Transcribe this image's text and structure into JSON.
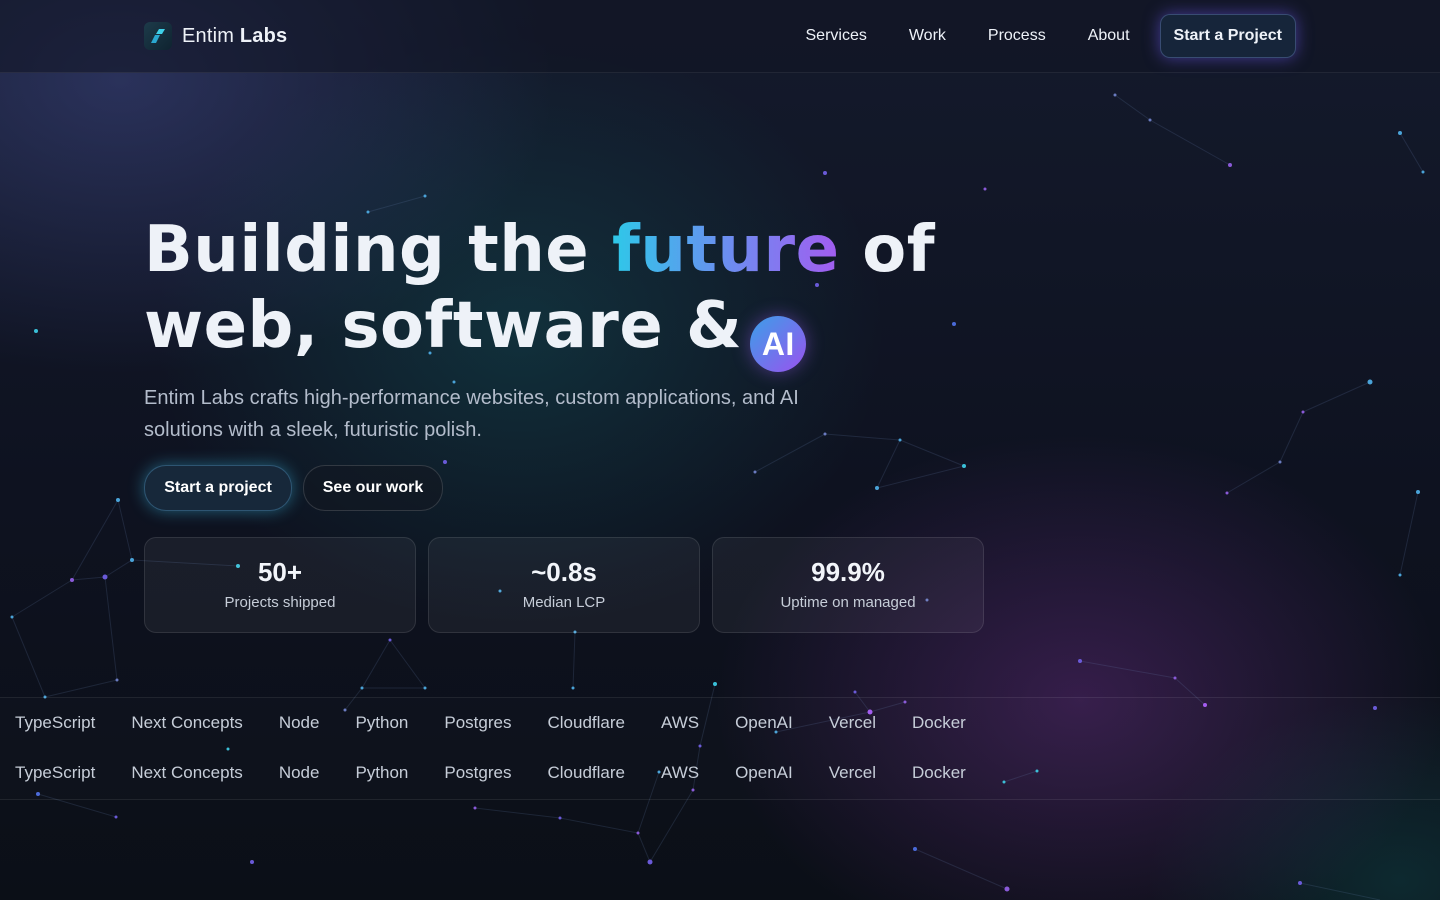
{
  "nav": {
    "brand_first": "Entim",
    "brand_second": "Labs",
    "links": [
      "Services",
      "Work",
      "Process",
      "About"
    ],
    "cta": "Start a Project"
  },
  "hero": {
    "title_part1": "Building the",
    "title_highlight": "future",
    "title_part2": "of",
    "title_line2": "web, software &",
    "ai_badge": "AI",
    "subtitle": "Entim Labs crafts high-performance websites, custom applications, and AI solutions with a sleek, futuristic polish.",
    "primary_button": "Start a project",
    "secondary_button": "See our work"
  },
  "stats": [
    {
      "value": "50+",
      "label": "Projects shipped"
    },
    {
      "value": "~0.8s",
      "label": "Median LCP"
    },
    {
      "value": "99.9%",
      "label": "Uptime on managed"
    }
  ],
  "tech_rows": [
    [
      "TypeScript",
      "Next Concepts",
      "Node",
      "Python",
      "Postgres",
      "Cloudflare",
      "AWS",
      "OpenAI",
      "Vercel",
      "Docker"
    ],
    [
      "TypeScript",
      "Next Concepts",
      "Node",
      "Python",
      "Postgres",
      "Cloudflare",
      "AWS",
      "OpenAI",
      "Vercel",
      "Docker"
    ]
  ],
  "colors": {
    "background": "#0c1018",
    "accent_cyan": "#2ec8e8",
    "accent_purple": "#a35cf0"
  }
}
